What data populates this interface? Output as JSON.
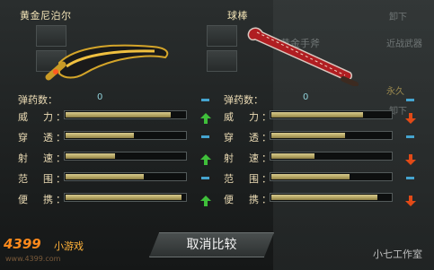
{
  "left_weapon": {
    "name": "黄金尼泊尔"
  },
  "right_weapon": {
    "name": "球棒"
  },
  "background": {
    "unload_1": "卸下",
    "gold_axe": "黄金手斧",
    "melee": "近战武器",
    "permanent": "永久",
    "unload_2": "卸下"
  },
  "stats": {
    "ammo_label": "弹药数：",
    "left_ammo": "0",
    "right_ammo": "0",
    "rows": [
      {
        "label": "威　力：",
        "left": 0.88,
        "right": 0.77,
        "left_change": "up",
        "right_change": "down"
      },
      {
        "label": "穿　透：",
        "left": 0.58,
        "right": 0.62,
        "left_change": "same",
        "right_change": "same"
      },
      {
        "label": "射　速：",
        "left": 0.42,
        "right": 0.37,
        "left_change": "up",
        "right_change": "down"
      },
      {
        "label": "范　围：",
        "left": 0.66,
        "right": 0.66,
        "left_change": "same",
        "right_change": "same"
      },
      {
        "label": "便　携：",
        "left": 0.97,
        "right": 0.89,
        "left_change": "up",
        "right_change": "down"
      }
    ]
  },
  "colors": {
    "up": "#3fbf3a",
    "down": "#e24a17",
    "same": "#45a4cf"
  },
  "buttons": {
    "cancel_compare": "取消比较"
  },
  "branding": {
    "logo": "4399",
    "logo_sub": "小游戏",
    "url": "www.4399.com",
    "watermark": "小七工作室"
  }
}
